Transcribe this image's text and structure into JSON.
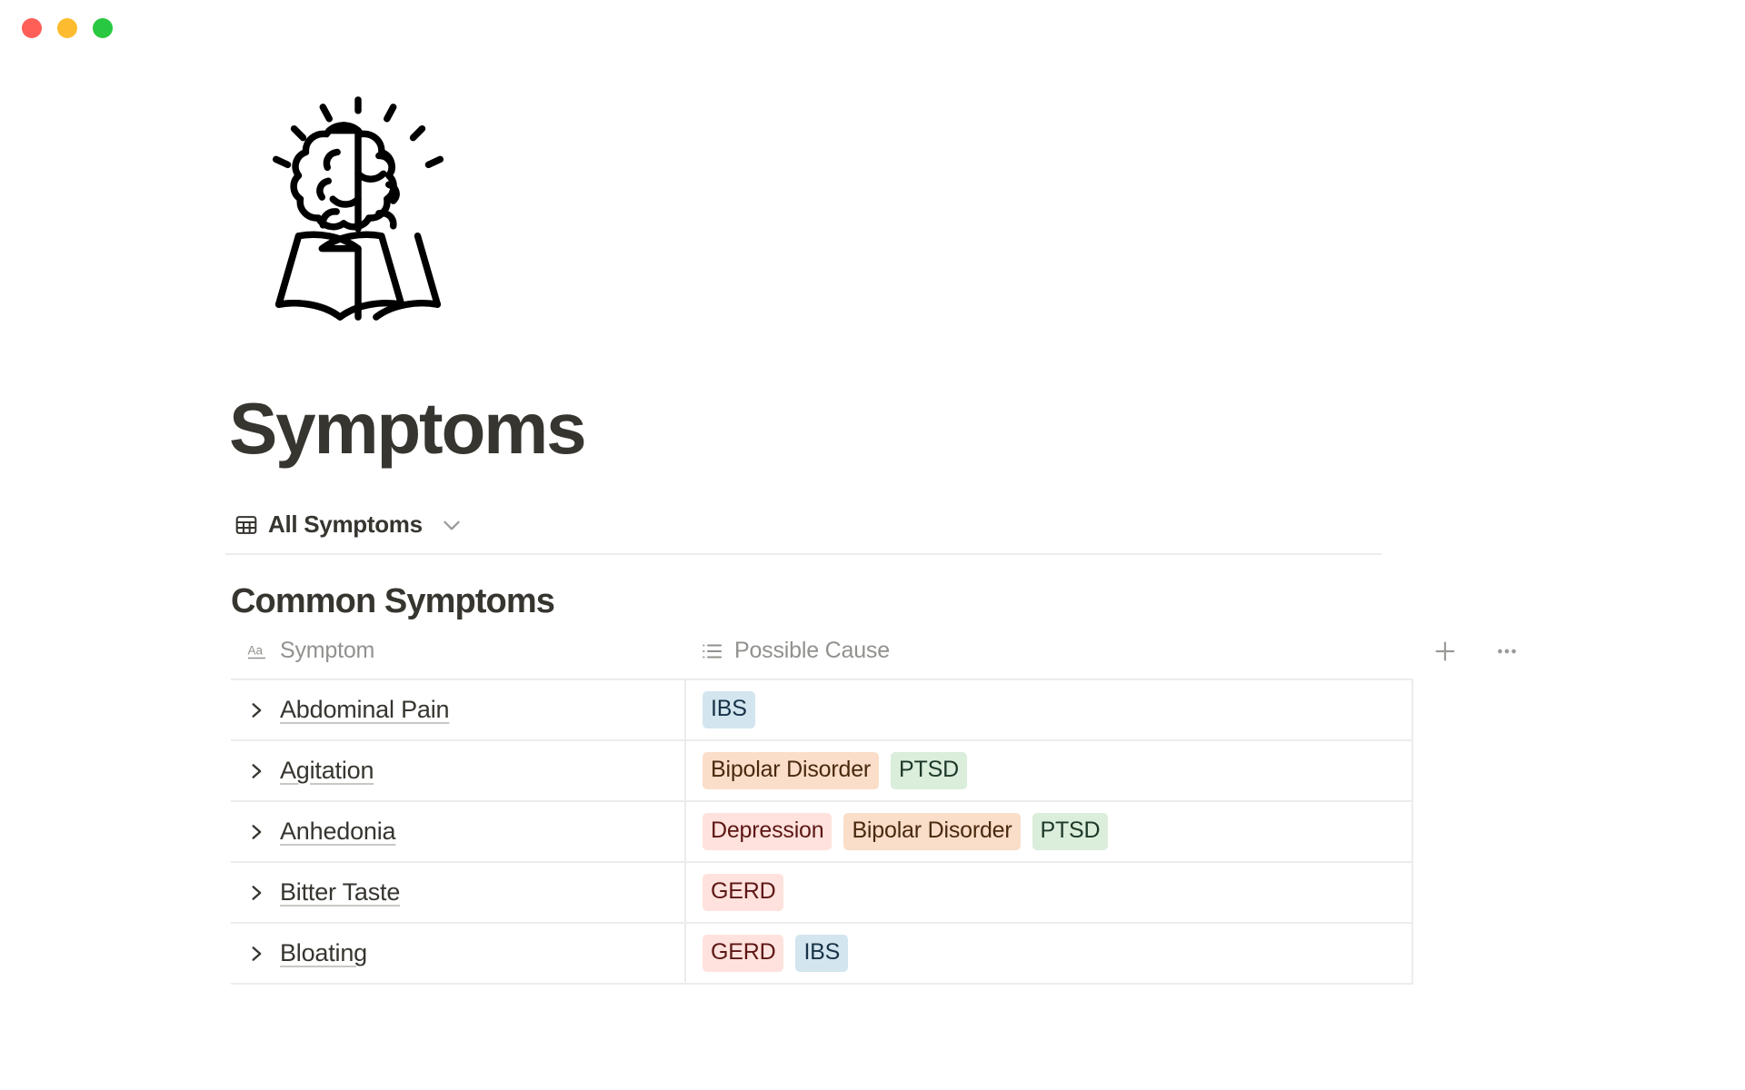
{
  "window": {
    "traffic_lights": [
      {
        "name": "close",
        "color": "#ff5f57"
      },
      {
        "name": "minimize",
        "color": "#fdbc2f"
      },
      {
        "name": "zoom",
        "color": "#28c840"
      }
    ]
  },
  "page": {
    "icon": "brain-book-icon",
    "title": "Symptoms"
  },
  "view": {
    "icon": "table-icon",
    "label": "All Symptoms",
    "chevron": "chevron-down-icon"
  },
  "section": {
    "title": "Common Symptoms"
  },
  "table": {
    "columns": [
      {
        "key": "symptom",
        "label": "Symptom",
        "icon": "text-type-icon"
      },
      {
        "key": "cause",
        "label": "Possible Cause",
        "icon": "multi-select-icon"
      }
    ],
    "actions": [
      {
        "name": "add-column-button",
        "icon": "plus-icon"
      },
      {
        "name": "more-options-button",
        "icon": "ellipsis-icon"
      }
    ],
    "rows": [
      {
        "symptom": "Abdominal Pain",
        "causes": [
          {
            "label": "IBS",
            "bg": "#d3e5ef",
            "fg": "#183347"
          }
        ]
      },
      {
        "symptom": "Agitation",
        "causes": [
          {
            "label": "Bipolar Disorder",
            "bg": "#fadec9",
            "fg": "#49290e"
          },
          {
            "label": "PTSD",
            "bg": "#dbeddb",
            "fg": "#1c3829"
          }
        ]
      },
      {
        "symptom": "Anhedonia",
        "causes": [
          {
            "label": "Depression",
            "bg": "#ffe2dd",
            "fg": "#5d1715"
          },
          {
            "label": "Bipolar Disorder",
            "bg": "#fadec9",
            "fg": "#49290e"
          },
          {
            "label": "PTSD",
            "bg": "#dbeddb",
            "fg": "#1c3829"
          }
        ]
      },
      {
        "symptom": "Bitter Taste",
        "causes": [
          {
            "label": "GERD",
            "bg": "#ffe2dd",
            "fg": "#5d1715"
          }
        ]
      },
      {
        "symptom": "Bloating",
        "causes": [
          {
            "label": "GERD",
            "bg": "#ffe2dd",
            "fg": "#5d1715"
          },
          {
            "label": "IBS",
            "bg": "#d3e5ef",
            "fg": "#183347"
          }
        ]
      }
    ]
  },
  "colors": {
    "text_primary": "#37352f",
    "text_muted": "#91918e",
    "border": "#ececeb",
    "background": "#ffffff"
  }
}
